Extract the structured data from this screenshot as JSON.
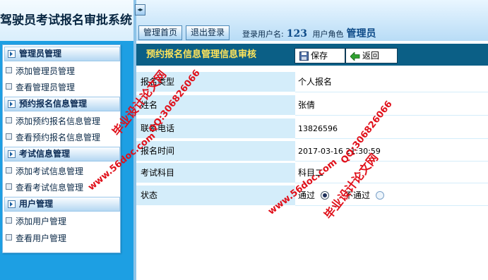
{
  "header": {
    "app_title": "驾驶员考试报名审批系统",
    "toggle_glyph": "◂▸",
    "home_button": "管理首页",
    "logout_button": "退出登录",
    "user_label": "登录用户名:",
    "username": "123",
    "role_label": "用户角色",
    "role": "管理员"
  },
  "sidebar": {
    "sections": [
      {
        "title": "管理员管理",
        "items": [
          "添加管理员管理",
          "查看管理员管理"
        ]
      },
      {
        "title": "预约报名信息管理",
        "items": [
          "添加预约报名信息管理",
          "查看预约报名信息管理"
        ]
      },
      {
        "title": "考试信息管理",
        "items": [
          "添加考试信息管理",
          "查看考试信息管理"
        ]
      },
      {
        "title": "用户管理",
        "items": [
          "添加用户管理",
          "查看用户管理"
        ]
      }
    ]
  },
  "main": {
    "title": "预约报名信息管理信息审核",
    "save_button": "保存",
    "back_button": "返回",
    "fields": [
      {
        "label": "报名类型",
        "value": "个人报名"
      },
      {
        "label": "姓名",
        "value": "张倩"
      },
      {
        "label": "联系电话",
        "value": "13826596"
      },
      {
        "label": "报名时间",
        "value": "2017-03-16 21:30:59"
      },
      {
        "label": "考试科目",
        "value": "科目二"
      }
    ],
    "status": {
      "label": "状态",
      "options": [
        "通过",
        "不通过"
      ],
      "selected": "通过"
    }
  },
  "watermark": {
    "site": "www.56doc.com",
    "qq": "QQ:306826066",
    "brand": "毕业设计论文网"
  },
  "colors": {
    "sidebar_bg": "#1d9fe3",
    "title_bar_bg": "#0b5f86",
    "title_text": "#ffe45a",
    "label_cell_bg": "#d4edfa",
    "watermark": "#e0101a"
  }
}
